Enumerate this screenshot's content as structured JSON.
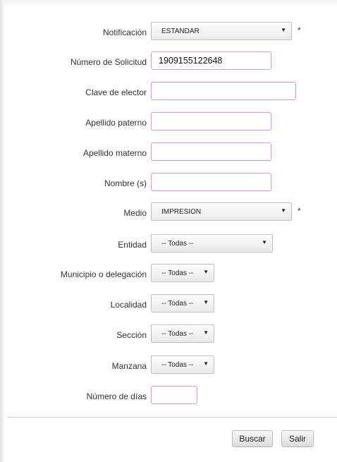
{
  "form": {
    "fields": [
      {
        "label": "Notificación",
        "type": "select",
        "value": "ESTANDAR",
        "required": true
      },
      {
        "label": "Número de Solicitud",
        "type": "text",
        "value": "1909155122648"
      },
      {
        "label": "Clave de elector",
        "type": "text",
        "value": ""
      },
      {
        "label": "Apellido paterno",
        "type": "text",
        "value": ""
      },
      {
        "label": "Apellido materno",
        "type": "text",
        "value": ""
      },
      {
        "label": "Nombre (s)",
        "type": "text",
        "value": ""
      },
      {
        "label": "Medio",
        "type": "select",
        "value": "IMPRESION",
        "required": true
      },
      {
        "label": "Entidad",
        "type": "select",
        "value": "-- Todas --"
      },
      {
        "label": "Municipio o delegación",
        "type": "select",
        "value": "-- Todas --"
      },
      {
        "label": "Localidad",
        "type": "select",
        "value": "-- Todas --"
      },
      {
        "label": "Sección",
        "type": "select",
        "value": "-- Todas --"
      },
      {
        "label": "Manzana",
        "type": "select",
        "value": "-- Todas --"
      },
      {
        "label": "Número de días",
        "type": "text",
        "value": ""
      }
    ],
    "required_marker": "*",
    "dropdown_arrow": "▼"
  },
  "buttons": {
    "search": "Buscar",
    "exit": "Salir"
  },
  "colors": {
    "input_border": "#e58fe0",
    "select_border": "#c2c2c2"
  }
}
